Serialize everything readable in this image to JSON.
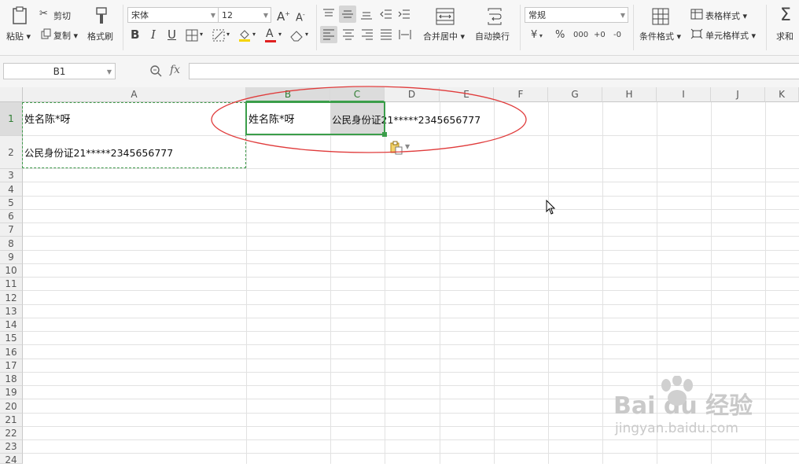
{
  "ribbon": {
    "paste": "粘贴",
    "cut": "剪切",
    "copy": "复制",
    "format_painter": "格式刷",
    "font_name": "宋体",
    "font_size": "12",
    "grow": "A",
    "shrink": "A",
    "bold": "B",
    "italic": "I",
    "underline": "U",
    "merge_center": "合并居中",
    "wrap_text": "自动换行",
    "number_format": "常规",
    "currency": "¥",
    "percent": "%",
    "thousands": "000",
    "dec_inc": "+0",
    "dec_dec": "-0",
    "cond_format": "条件格式",
    "table_style": "表格样式",
    "cell_style": "单元格样式",
    "sum": "求和"
  },
  "formula_bar": {
    "name_box": "B1",
    "fx_label": "fx",
    "content": ""
  },
  "columns": [
    "A",
    "B",
    "C",
    "D",
    "E",
    "F",
    "G",
    "H",
    "I",
    "J",
    "K"
  ],
  "rows": [
    "1",
    "2",
    "3",
    "4",
    "5",
    "6",
    "7",
    "8",
    "9",
    "10",
    "11",
    "12",
    "13",
    "14",
    "15",
    "16",
    "17",
    "18",
    "19",
    "20",
    "21",
    "22",
    "23",
    "24"
  ],
  "cells": {
    "A1": "姓名陈*呀",
    "A2": "公民身份证21*****2345656777",
    "B1": "姓名陈*呀",
    "C1": "公民身份证21*****2345656777"
  },
  "watermark": {
    "brand": "Bai du 经验",
    "url": "jingyan.baidu.com"
  }
}
